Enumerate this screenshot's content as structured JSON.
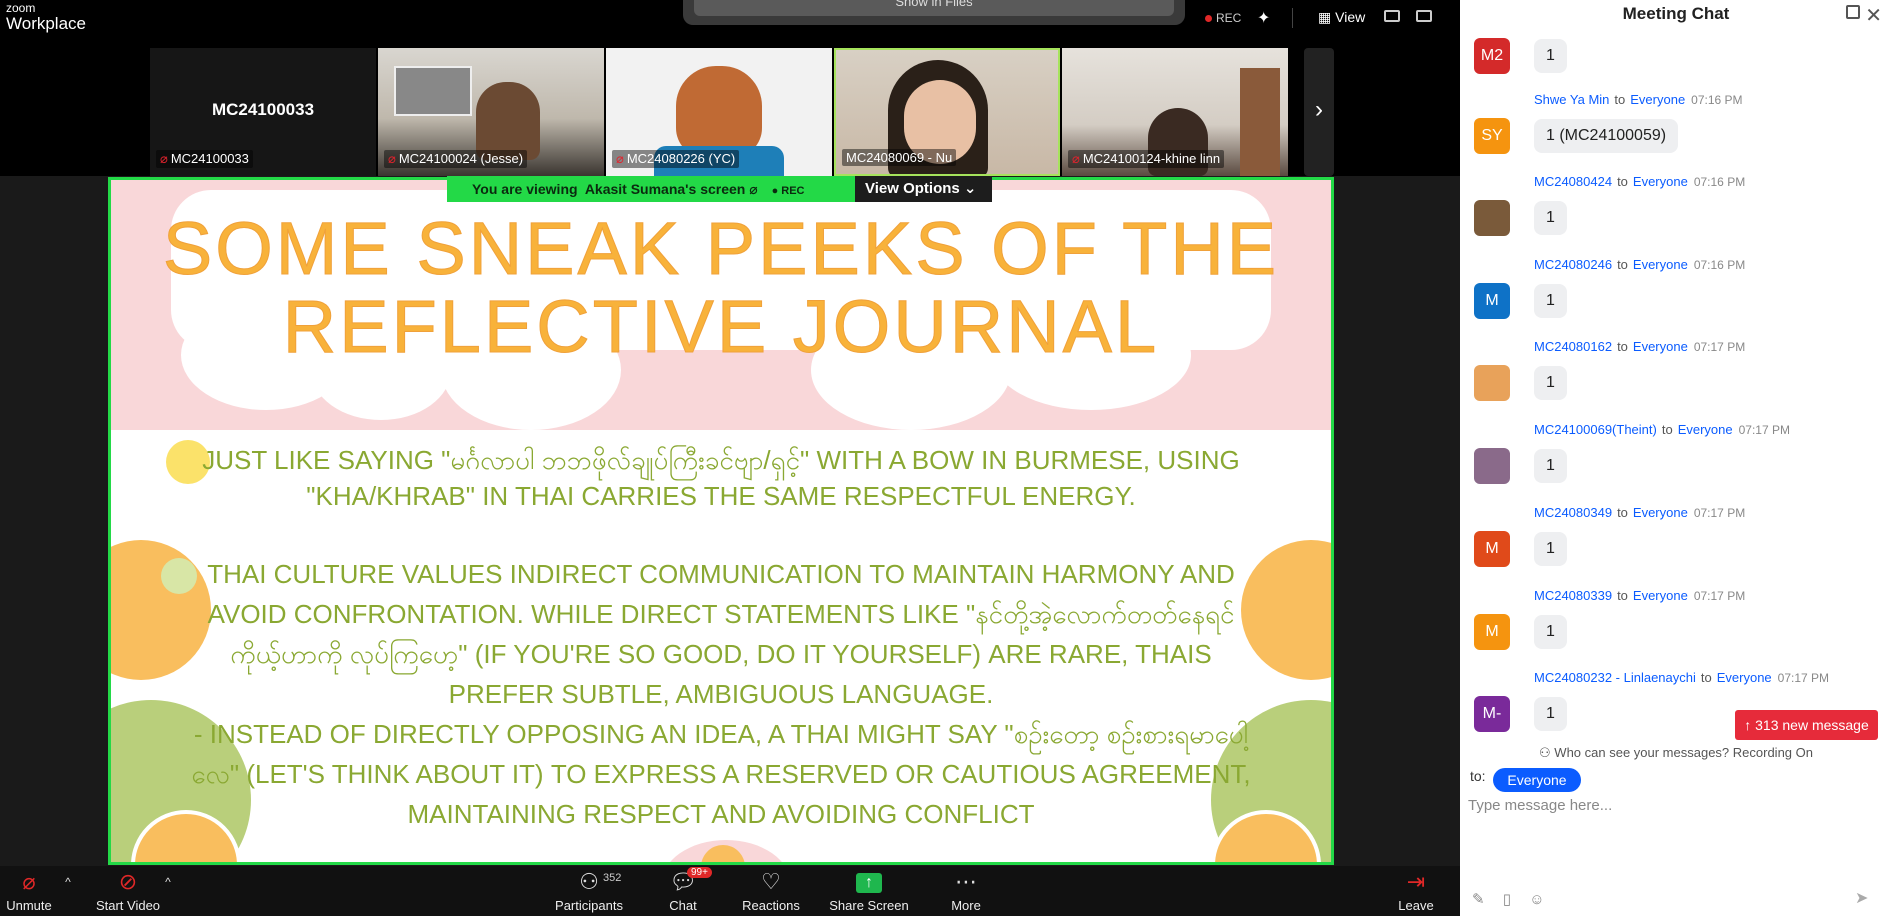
{
  "app": {
    "brand_line1": "zoom",
    "brand_line2": "Workplace"
  },
  "topbar": {
    "show_in_files": "Show in Files",
    "rec_label": "REC",
    "view_label": "View"
  },
  "gallery": {
    "tiles": [
      {
        "label": "MC24100033",
        "avatar_text": "MC24100033"
      },
      {
        "label": "MC24100024 (Jesse)"
      },
      {
        "label": "MC24080226 (YC)"
      },
      {
        "label": "MC24080069 - Nu"
      },
      {
        "label": "MC24100124-khine linn"
      }
    ]
  },
  "share": {
    "viewing_prefix": "You are viewing",
    "viewing_name": "Akasit Sumana's screen",
    "rec_label": "REC",
    "view_options": "View Options",
    "title_line1": "SOME SNEAK PEEKS OF THE",
    "title_line2": "REFLECTIVE JOURNAL",
    "para1": "JUST LIKE SAYING \"မင်္ဂလာပါ ဘဘဖိုလ်ချုပ်ကြီးခင်ဗျာ/ရှင့်\" WITH A BOW IN BURMESE, USING \"KHA/KHRAB\" IN THAI CARRIES THE SAME RESPECTFUL ENERGY.",
    "para2": "THAI CULTURE VALUES INDIRECT COMMUNICATION TO MAINTAIN HARMONY AND AVOID CONFRONTATION. WHILE DIRECT STATEMENTS LIKE \"နင်တို့အဲ့လောက်တတ်နေရင် ကိုယ့်ဟာကို လုပ်ကြဟေ့\" (IF YOU'RE SO GOOD, DO IT YOURSELF) ARE RARE, THAIS PREFER SUBTLE, AMBIGUOUS LANGUAGE.",
    "para3": "- INSTEAD OF DIRECTLY OPPOSING AN IDEA, A THAI MIGHT SAY \"စဥ်းတော့ စဥ်းစားရမာပေါ့လေ\" (LET'S THINK ABOUT IT) TO EXPRESS A RESERVED OR CAUTIOUS AGREEMENT, MAINTAINING RESPECT AND AVOIDING CONFLICT"
  },
  "toolbar": {
    "unmute": "Unmute",
    "start_video": "Start Video",
    "participants": "Participants",
    "participants_count": "352",
    "chat": "Chat",
    "chat_badge": "99+",
    "reactions": "Reactions",
    "share_screen": "Share Screen",
    "more": "More",
    "leave": "Leave"
  },
  "chat": {
    "title": "Meeting Chat",
    "to_word": "to",
    "messages": [
      {
        "avatar": "M2",
        "color": "#d42a2a",
        "sender": "",
        "recipient": "",
        "time": "",
        "text": "1"
      },
      {
        "avatar": "SY",
        "color": "#f5940f",
        "sender": "Shwe Ya Min",
        "recipient": "Everyone",
        "time": "07:16 PM",
        "text": "1 (MC24100059)"
      },
      {
        "avatar": "",
        "color": "#7a5a3a",
        "sender": "MC24080424",
        "recipient": "Everyone",
        "time": "07:16 PM",
        "text": "1"
      },
      {
        "avatar": "M",
        "color": "#0e72c7",
        "sender": "MC24080246",
        "recipient": "Everyone",
        "time": "07:16 PM",
        "text": "1"
      },
      {
        "avatar": "",
        "color": "#e8a25a",
        "sender": "MC24080162",
        "recipient": "Everyone",
        "time": "07:17 PM",
        "text": "1"
      },
      {
        "avatar": "",
        "color": "#8a6a8a",
        "sender": "MC24100069(Theint)",
        "recipient": "Everyone",
        "time": "07:17 PM",
        "text": "1"
      },
      {
        "avatar": "M",
        "color": "#e04a1a",
        "sender": "MC24080349",
        "recipient": "Everyone",
        "time": "07:17 PM",
        "text": "1"
      },
      {
        "avatar": "M",
        "color": "#f5940f",
        "sender": "MC24080339",
        "recipient": "Everyone",
        "time": "07:17 PM",
        "text": "1"
      },
      {
        "avatar": "M-",
        "color": "#7a2a9a",
        "sender": "MC24080232 - Linlaenaychi",
        "recipient": "Everyone",
        "time": "07:17 PM",
        "text": "1"
      }
    ],
    "new_messages": "↑ 313 new message",
    "who_can_see": "Who can see your messages? Recording On",
    "to_label": "to:",
    "to_value": "Everyone",
    "input_placeholder": "Type message here..."
  }
}
